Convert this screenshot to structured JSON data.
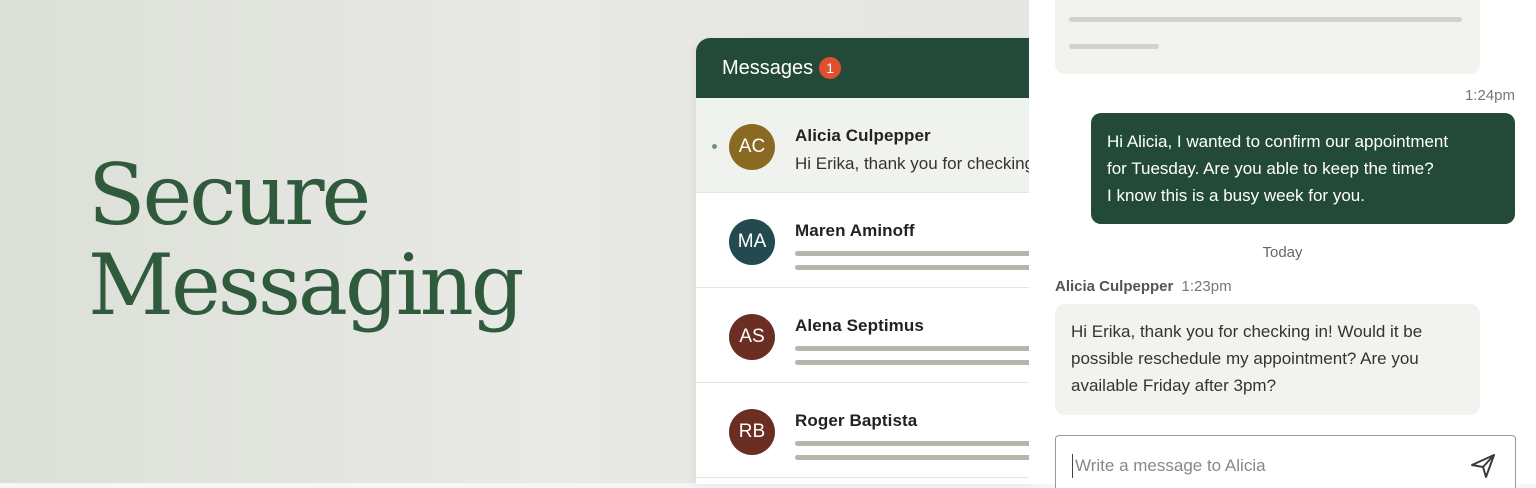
{
  "hero": {
    "line1": "Secure",
    "line2": "Messaging"
  },
  "inbox": {
    "title": "Messages",
    "unread_count": "1",
    "conversations": [
      {
        "initials": "AC",
        "name": "Alicia Culpepper",
        "preview": "Hi Erika, thank you for checking in! Would it be",
        "avatar_color": "#8a6a22",
        "unread": true
      },
      {
        "initials": "MA",
        "name": "Maren Aminoff",
        "avatar_color": "#234a4f"
      },
      {
        "initials": "AS",
        "name": "Alena Septimus",
        "avatar_color": "#6b2e22"
      },
      {
        "initials": "RB",
        "name": "Roger Baptista",
        "avatar_color": "#6b2e22"
      }
    ]
  },
  "chat": {
    "sent_time": "1:24pm",
    "sent_lines": [
      "Hi Alicia, I wanted to confirm our appointment",
      "for Tuesday. Are you able to keep the time?",
      "I know this is a busy week for you."
    ],
    "day_divider": "Today",
    "received_sender": "Alicia Culpepper",
    "received_time": "1:23pm",
    "received_lines": [
      "Hi Erika, thank you for checking in! Would it be",
      "possible reschedule my appointment? Are you",
      "available Friday after 3pm?"
    ],
    "composer_placeholder": "Write a message to Alicia"
  },
  "colors": {
    "brand_green": "#234a39",
    "hero_green": "#2f5a3c",
    "badge_red": "#e0502f"
  },
  "icons": {
    "send": "send-icon"
  }
}
